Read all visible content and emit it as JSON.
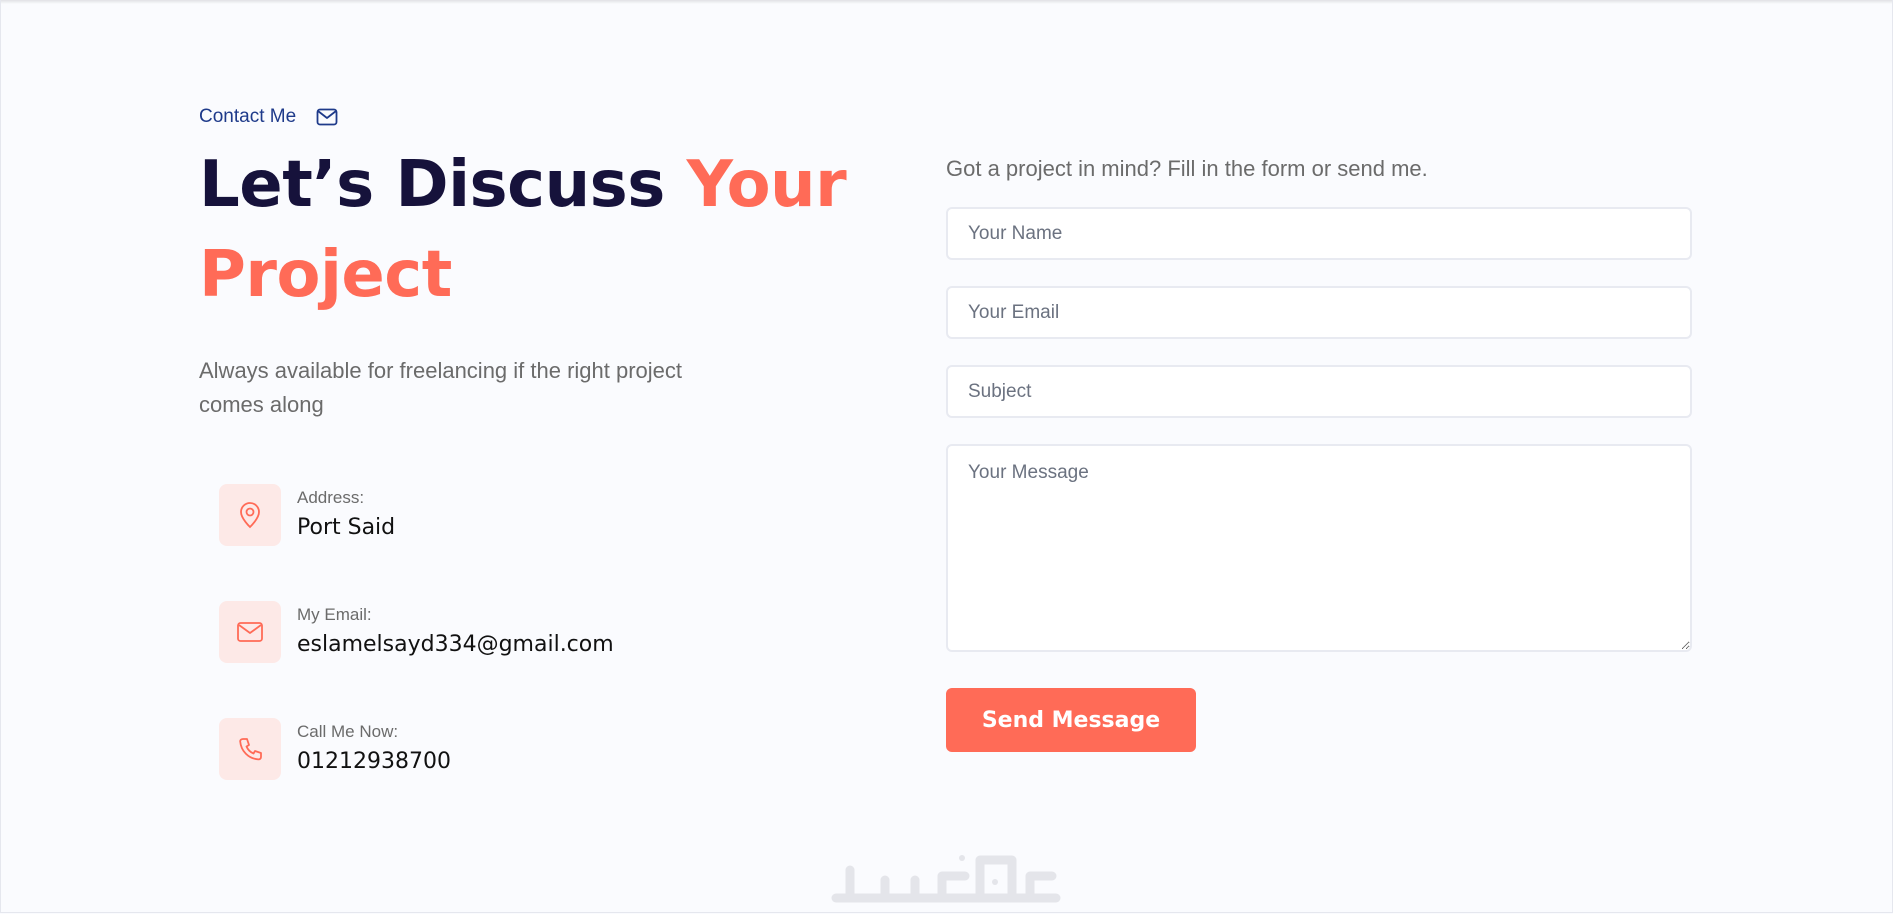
{
  "contact_section": {
    "eyebrow_label": "Contact Me",
    "eyebrow_icon": "mail-icon",
    "heading_part1": "Let’s Discuss ",
    "heading_accent": "Your Project",
    "intro": "Always available for freelancing if the right project comes along",
    "items": [
      {
        "icon": "map-pin-icon",
        "label": "Address:",
        "value": "Port Said"
      },
      {
        "icon": "mail-icon",
        "label": "My Email:",
        "value": "eslamelsayd334@gmail.com"
      },
      {
        "icon": "phone-icon",
        "label": "Call Me Now:",
        "value": "01212938700"
      }
    ]
  },
  "form": {
    "intro": "Got a project in mind? Fill in the form or send me.",
    "name_placeholder": "Your Name",
    "email_placeholder": "Your Email",
    "subject_placeholder": "Subject",
    "message_placeholder": "Your Message",
    "submit_label": "Send Message"
  },
  "watermark": {
    "logo_text": "خمسات"
  },
  "colors": {
    "accent": "#ff6b57",
    "heading": "#16123b",
    "eyebrow": "#1e3a8a",
    "icon_box_bg": "#fde9e7",
    "page_bg": "#fafbfe"
  }
}
